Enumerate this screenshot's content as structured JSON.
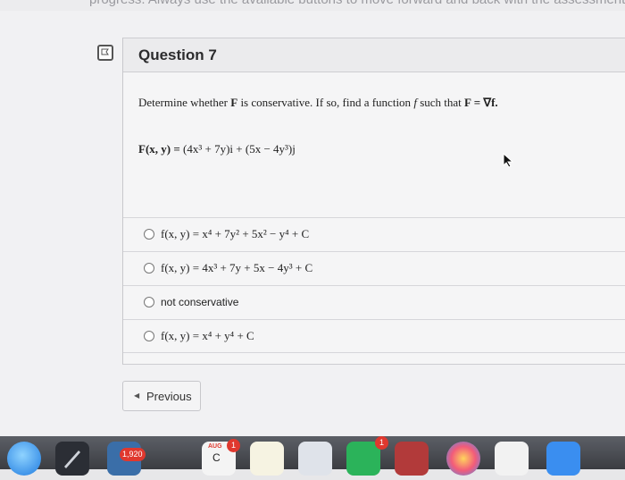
{
  "top_strip": {
    "text": "progress. Always use the available buttons to move forward and back with the assessment"
  },
  "question": {
    "title": "Question 7",
    "prompt_start": "Determine whether ",
    "prompt_F": "F",
    "prompt_mid": " is conservative. If so, find a function ",
    "prompt_f": "f",
    "prompt_end": " such that ",
    "prompt_formula": "F = ∇f.",
    "field_lhs": "F(x, y) = ",
    "field_i_part": "(4x³ + 7y)i",
    "field_plus": " + ",
    "field_j_part": "(5x − 4y³)j"
  },
  "options": [
    {
      "text": "f(x, y) = x⁴ + 7y² + 5x² − y⁴ + C",
      "style": "serif"
    },
    {
      "text": "f(x, y) = 4x³ + 7y + 5x − 4y³ + C",
      "style": "serif"
    },
    {
      "text": "not conservative",
      "style": "sans"
    },
    {
      "text": "f(x, y) = x⁴ + y⁴ + C",
      "style": "serif"
    }
  ],
  "navigation": {
    "previous_label": "Previous"
  },
  "dock": {
    "badge_screenshot": "1,920",
    "calendar_month": "AUG",
    "calendar_badge": "1",
    "calendar_day": "C",
    "reminder_badge": "1"
  },
  "colors": {
    "dock_badge": "#e0382e",
    "page_background": "#f1f1f3",
    "card_header": "#ebebed"
  },
  "icons": [
    "flag-icon",
    "previous-arrow-icon",
    "mouse-cursor-icon"
  ]
}
